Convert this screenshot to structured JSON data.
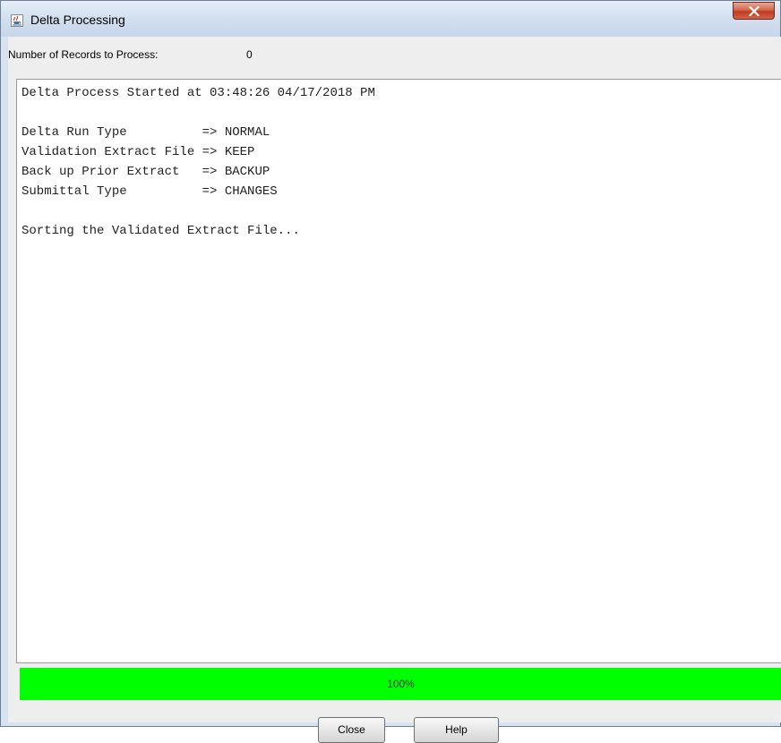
{
  "window": {
    "title": "Delta Processing",
    "icon": "java-cup-icon"
  },
  "records": {
    "label": "Number of Records to Process:",
    "value": "0"
  },
  "log": {
    "lines": [
      "Delta Process Started at 03:48:26 04/17/2018 PM",
      "",
      "Delta Run Type          => NORMAL",
      "Validation Extract File => KEEP",
      "Back up Prior Extract   => BACKUP",
      "Submittal Type          => CHANGES",
      "",
      "Sorting the Validated Extract File..."
    ]
  },
  "progress": {
    "percent": 100,
    "label": "100%",
    "color": "#00ff00"
  },
  "buttons": {
    "close_label": "Close",
    "help_label": "Help"
  }
}
